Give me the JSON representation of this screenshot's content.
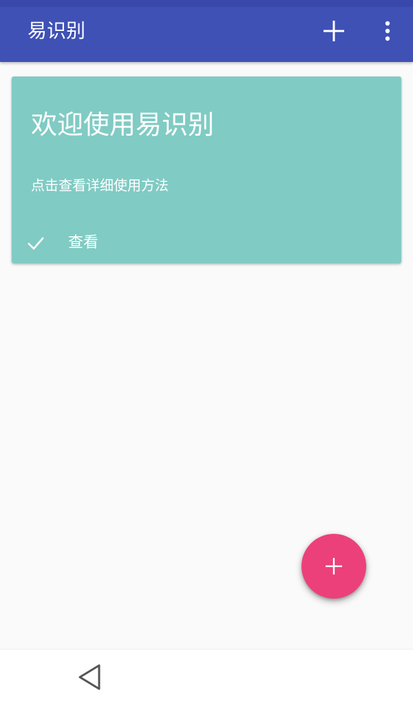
{
  "colors": {
    "status_bar": "#3949ab",
    "app_bar": "#3f51b5",
    "card": "#80cbc4",
    "fab": "#ec407a",
    "background": "#fafafa",
    "nav_bar": "#ffffff",
    "nav_icon": "#555555"
  },
  "app_bar": {
    "title": "易识别",
    "add_icon": "plus-icon",
    "more_icon": "more-vert-icon"
  },
  "card": {
    "title": "欢迎使用易识别",
    "subtitle": "点击查看详细使用方法",
    "action_icon": "check-icon",
    "action_label": "查看"
  },
  "fab": {
    "icon": "plus-icon"
  },
  "nav_bar": {
    "back_icon": "back-triangle-icon"
  }
}
